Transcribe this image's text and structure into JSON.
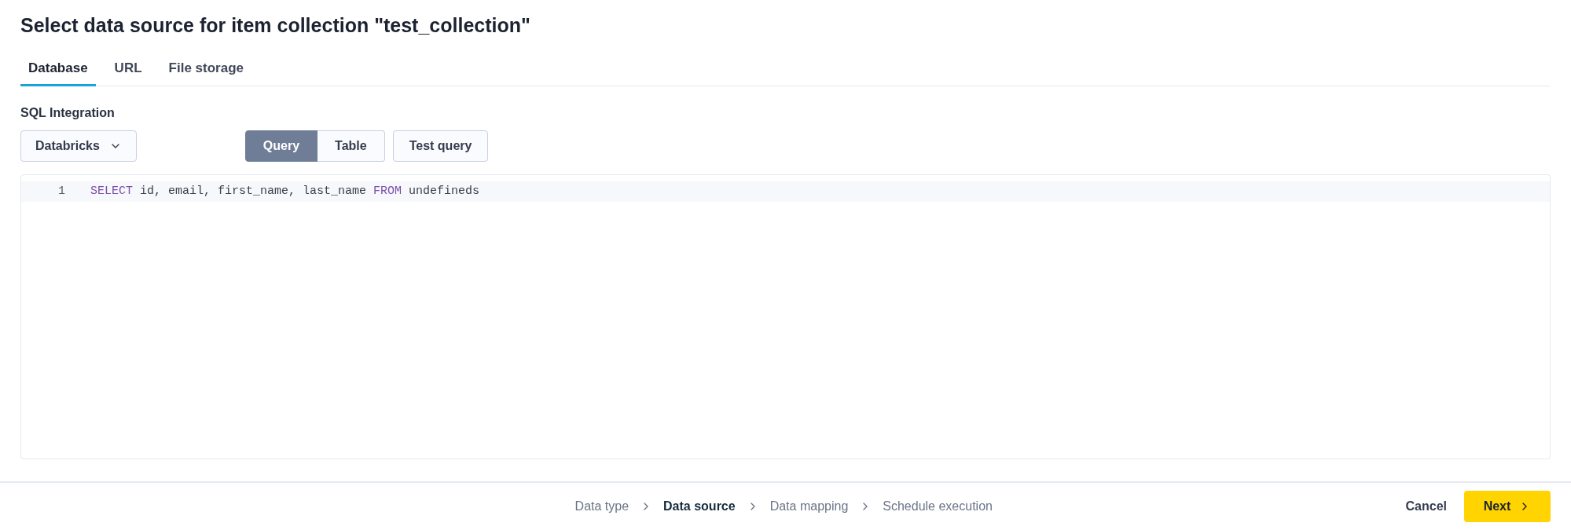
{
  "title": "Select data source for item collection \"test_collection\"",
  "tabs": [
    {
      "label": "Database",
      "selected": true
    },
    {
      "label": "URL",
      "selected": false
    },
    {
      "label": "File storage",
      "selected": false
    }
  ],
  "integration": {
    "label": "SQL Integration",
    "value": "Databricks"
  },
  "mode_toggle": [
    {
      "label": "Query",
      "selected": true
    },
    {
      "label": "Table",
      "selected": false
    }
  ],
  "test_button": "Test query",
  "editor": {
    "lines": [
      {
        "number": "1",
        "tokens": [
          {
            "kind": "keyword",
            "text": "SELECT"
          },
          {
            "kind": "plain",
            "text": " id, email, first_name, last_name "
          },
          {
            "kind": "keyword",
            "text": "FROM"
          },
          {
            "kind": "plain",
            "text": " undefineds"
          }
        ]
      }
    ]
  },
  "steps": [
    {
      "label": "Data type",
      "selected": false
    },
    {
      "label": "Data source",
      "selected": true
    },
    {
      "label": "Data mapping",
      "selected": false
    },
    {
      "label": "Schedule execution",
      "selected": false
    }
  ],
  "cancel_button": "Cancel",
  "next_button": "Next"
}
